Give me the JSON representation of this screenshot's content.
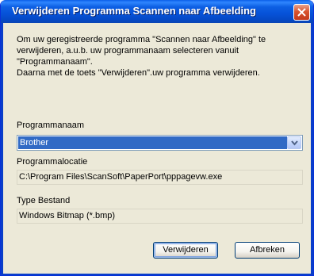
{
  "window": {
    "title": "Verwijderen Programma Scannen naar Afbeelding"
  },
  "instructions": {
    "lines": [
      "Om uw geregistreerde programma \"Scannen naar Afbeelding\" te",
      "verwijderen, a.u.b. uw programmanaam selecteren vanuit",
      "\"Programmanaam\".",
      "Daarna met de toets \"Verwijderen\".uw programma verwijderen."
    ]
  },
  "program_name": {
    "label": "Programmanaam",
    "selected": "Brother"
  },
  "program_location": {
    "label": "Programmalocatie",
    "value": "C:\\Program Files\\ScanSoft\\PaperPort\\pppagevw.exe"
  },
  "file_type": {
    "label": "Type Bestand",
    "value": "Windows Bitmap (*.bmp)"
  },
  "buttons": {
    "delete": "Verwijderen",
    "cancel": "Afbreken"
  },
  "colors": {
    "titlebar": "#0652d8",
    "selection": "#316ac5",
    "dialog_bg": "#ece9d8"
  },
  "icons": {
    "close": "close-icon",
    "dropdown": "chevron-down-icon"
  }
}
